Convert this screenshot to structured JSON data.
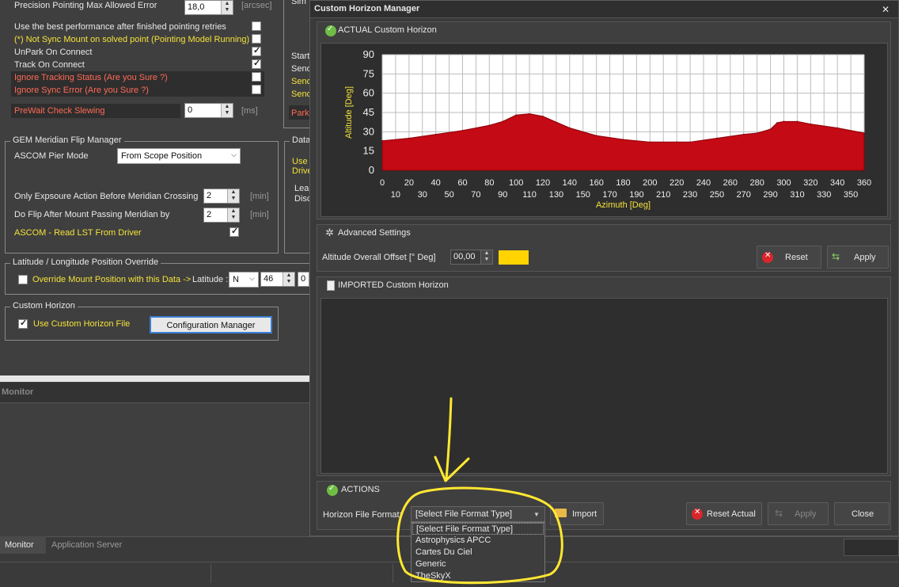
{
  "left": {
    "precision_label": "Precision Pointing Max Allowed Error",
    "precision_value": "18,0",
    "precision_unit": "[arcsec]",
    "best_perf_label": "Use the best performance after finished pointing retries",
    "not_sync_label": "(*) Not Sync Mount on solved point (Pointing Model Running)",
    "unpark_label": "UnPark On Connect",
    "track_label": "Track On Connect",
    "ignore_tracking_label": "Ignore Tracking Status (Are you Sure ?)",
    "ignore_sync_label": "Ignore Sync Error (Are you Sure ?)",
    "prewait_label": "PreWait Check Slewing",
    "prewait_value": "0",
    "prewait_unit": "[ms]",
    "right_col": [
      "Start",
      "Send",
      "Send",
      "Send",
      "Park"
    ],
    "sim_label": "Sim",
    "gem": {
      "title": "GEM Meridian Flip Manager",
      "pier_label": "ASCOM Pier Mode",
      "pier_value": "From Scope Position",
      "only_exp_label": "Only Expsoure Action Before Meridian Crossing",
      "only_exp_value": "2",
      "only_exp_unit": "[min]",
      "do_flip_label": "Do Flip After Mount Passing Meridian by",
      "do_flip_value": "2",
      "do_flip_unit": "[min]",
      "read_lst_label": "ASCOM - Read LST From Driver"
    },
    "data_group": {
      "title": "Data",
      "l1": "Use",
      "l2": "Drive",
      "l3": "Lea",
      "l4": "Disc"
    },
    "latlon": {
      "title": "Latitude / Longitude Position Override",
      "override_label": "Override Mount Position with this Data ->",
      "lat_label": "Latitude :",
      "lat_dir": "N",
      "lat_deg": "46",
      "lat_min": "0"
    },
    "horizon": {
      "title": "Custom Horizon",
      "use_label": "Use Custom Horizon File",
      "config_button": "Configuration Manager"
    },
    "monitor_header": "Monitor",
    "tabs": [
      "Monitor",
      "Application Server"
    ]
  },
  "dialog": {
    "title": "Custom Horizon Manager",
    "close_glyph": "✕",
    "actual_header": "ACTUAL Custom Horizon",
    "advanced_header": "Advanced Settings",
    "offset_label": "Altitude Overall Offset [° Deg]",
    "offset_value": "00,00",
    "offset_color": "#ffd400",
    "reset_label": "Reset",
    "apply_label": "Apply",
    "imported_header": "IMPORTED Custom Horizon",
    "actions_header": "ACTIONS",
    "format_label": "Horizon File Format:",
    "format_selected": "[Select File Format Type]",
    "format_options": [
      "[Select File Format Type]",
      "Astrophysics APCC",
      "Cartes Du Ciel",
      "Generic",
      "TheSkyX"
    ],
    "import_label": "Import",
    "reset_actual_label": "Reset Actual",
    "apply2_label": "Apply",
    "close_label": "Close"
  },
  "chart_data": {
    "type": "area",
    "xlabel": "Azimuth [Deg]",
    "ylabel": "Altitude [Deg]",
    "xlim": [
      0,
      360
    ],
    "ylim": [
      0,
      90
    ],
    "x_ticks_top": [
      "0",
      "20",
      "40",
      "60",
      "80",
      "100",
      "120",
      "140",
      "160",
      "180",
      "200",
      "220",
      "240",
      "260",
      "280",
      "300",
      "320",
      "340",
      "360"
    ],
    "x_ticks_bottom": [
      "10",
      "30",
      "50",
      "70",
      "90",
      "110",
      "130",
      "150",
      "170",
      "190",
      "210",
      "230",
      "250",
      "270",
      "290",
      "310",
      "330",
      "350"
    ],
    "y_ticks": [
      "0",
      "15",
      "30",
      "45",
      "60",
      "75",
      "90"
    ],
    "grid": true,
    "fill_color": "#c40a14",
    "series": [
      {
        "x": [
          0,
          20,
          40,
          60,
          80,
          90,
          100,
          110,
          120,
          140,
          160,
          180,
          200,
          220,
          230,
          250,
          270,
          280,
          290,
          295,
          300,
          310,
          320,
          340,
          360
        ],
        "values": [
          23,
          25,
          28,
          31,
          35,
          38,
          43,
          44,
          42,
          33,
          27,
          24,
          22,
          22,
          22,
          25,
          28,
          29,
          32,
          37,
          38,
          38,
          36,
          33,
          29
        ]
      }
    ]
  }
}
